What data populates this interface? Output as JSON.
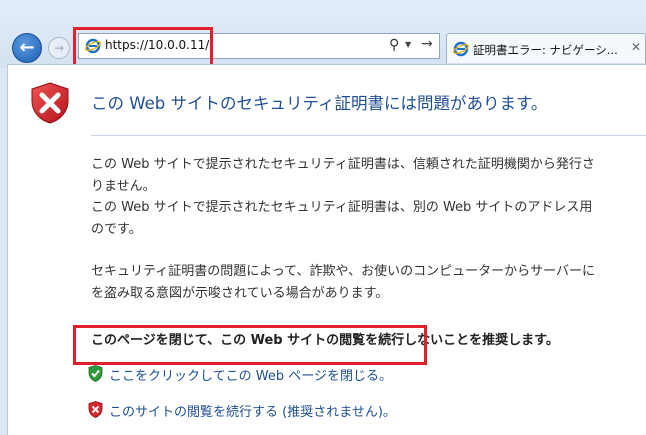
{
  "browser": {
    "address_url": "https://10.0.0.11/",
    "tab_title": "証明書エラー: ナビゲーシ..."
  },
  "page": {
    "title": "この Web サイトのセキュリティ証明書には問題があります。",
    "paragraph1_lines": [
      "この Web サイトで提示されたセキュリティ証明書は、信頼された証明機関から発行さ",
      "りません。",
      "この Web サイトで提示されたセキュリティ証明書は、別の Web サイトのアドレス用",
      "のです。"
    ],
    "paragraph2_lines": [
      "セキュリティ証明書の問題によって、詐欺や、お使いのコンピューターからサーバーに",
      "を盗み取る意図が示唆されている場合があります。"
    ],
    "recommendation": "このページを閉じて、この Web サイトの閲覧を続行しないことを推奨します。",
    "close_link": "ここをクリックしてこの Web ページを閉じる。",
    "continue_link": "このサイトの閲覧を続行する (推奨されません)。"
  },
  "colors": {
    "highlight": "#e0202c",
    "link": "#1f4f95",
    "title": "#1f4f95"
  }
}
